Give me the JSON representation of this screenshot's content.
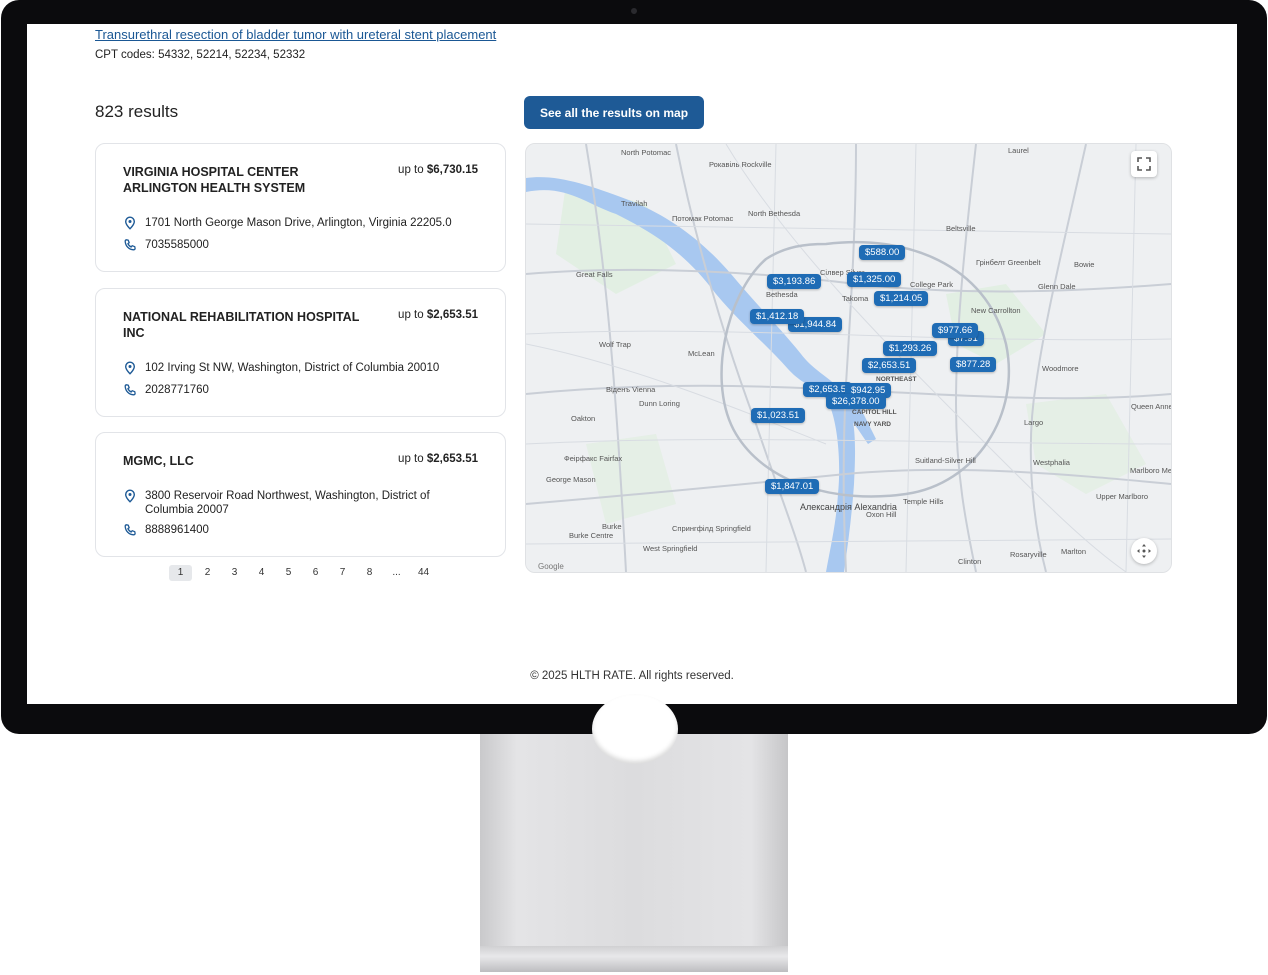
{
  "procedure": {
    "title": "Transurethral resection of bladder tumor with ureteral stent placement",
    "cpt_codes": "CPT codes: 54332, 52214, 52234, 52332"
  },
  "results": {
    "count_label": "823 results",
    "map_button": "See all the results on map",
    "items": [
      {
        "name": "VIRGINIA HOSPITAL CENTER ARLINGTON HEALTH SYSTEM",
        "price_prefix": "up to",
        "price": "$6,730.15",
        "address": "1701 North George Mason Drive, Arlington, Virginia 22205.0",
        "phone": "7035585000"
      },
      {
        "name": "NATIONAL REHABILITATION HOSPITAL INC",
        "price_prefix": "up to",
        "price": "$2,653.51",
        "address": "102 Irving St NW, Washington, District of Columbia 20010",
        "phone": "2028771760"
      },
      {
        "name": "MGMC, LLC",
        "price_prefix": "up to",
        "price": "$2,653.51",
        "address": "3800 Reservoir Road Northwest, Washington, District of Columbia 20007",
        "phone": "8888961400"
      }
    ]
  },
  "pagination": [
    "1",
    "2",
    "3",
    "4",
    "5",
    "6",
    "7",
    "8",
    "...",
    "44"
  ],
  "pagination_active": "1",
  "map": {
    "price_pins": [
      "$588.00",
      "$3,193.86",
      "$1,325.00",
      "$1,214.05",
      "$1,412.18",
      "$1,944.84",
      "$977.66",
      "$7.91",
      "$1,293.26",
      "$2,653.51",
      "$877.28",
      "$2,653.5",
      "$942.95",
      "$26,378.00",
      "$1,023.51",
      "$1,847.01"
    ],
    "place_labels": [
      "North Potomac",
      "Рокавіль Rockville",
      "Travilah",
      "Потомак Potomac",
      "North Bethesda",
      "Great Falls",
      "Bethesda",
      "Сілвер Silver",
      "Takoma",
      "College Park",
      "Beltsville",
      "Грінбелт Greenbelt",
      "Bowie",
      "Glenn Dale",
      "New Carrollton",
      "Wolf Trap",
      "McLean",
      "Віденъ Vienna",
      "Dunn Loring",
      "Oakton",
      "Феірфакс Fairfax",
      "George Mason",
      "Burke",
      "Burke Centre",
      "Спрингфілд Springfield",
      "West Springfield",
      "Александрія Alexandria",
      "Oxon Hill",
      "Temple Hills",
      "Suitland-Silver Hill",
      "Westphalia",
      "Largo",
      "Woodmore",
      "Marlboro Meadows",
      "Upper Marlboro",
      "Queen Anne Estates",
      "Clinton",
      "Rosaryville",
      "Marlton",
      "Laurel",
      "CAPITOL HILL",
      "NAVY YARD",
      "NORTHEAST",
      "Google"
    ],
    "fullscreen_icon": "fullscreen-icon",
    "recenter_icon": "recenter-icon"
  },
  "footer": "© 2025 HLTH RATE. All rights reserved.",
  "colors": {
    "accent": "#1e5a96",
    "pin": "#1f6cb5",
    "link": "#1a5794",
    "water": "#a8c8f0",
    "park": "#dbeed9"
  }
}
